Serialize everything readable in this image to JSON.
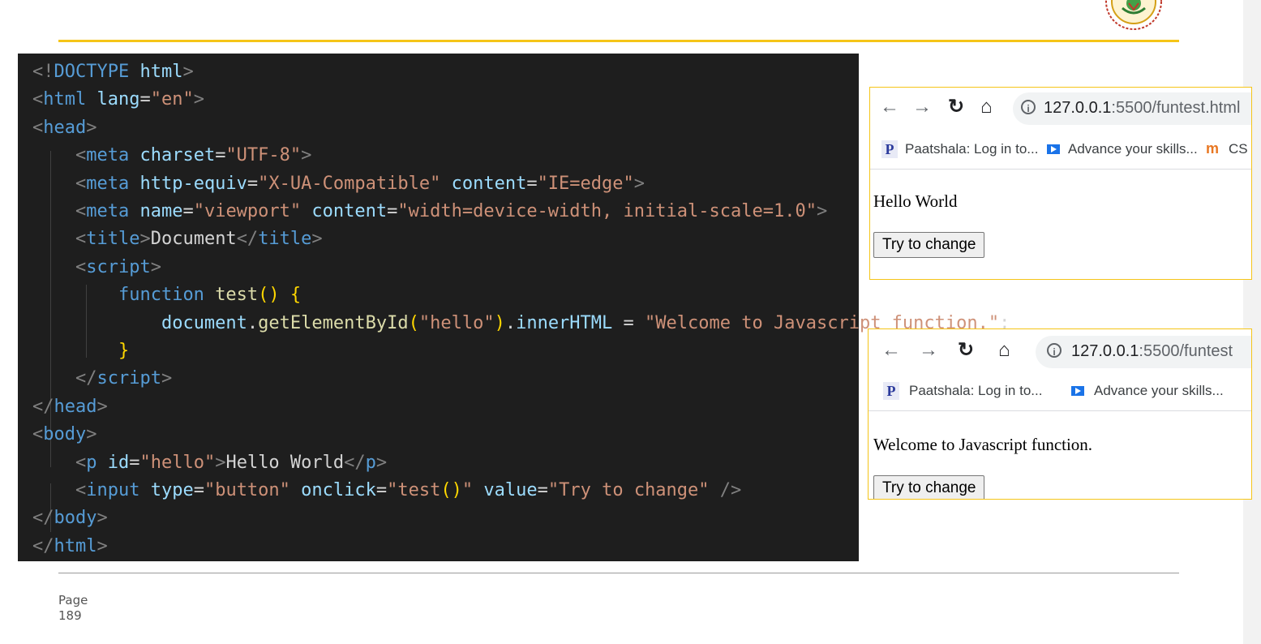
{
  "code_lines": [
    {
      "indent": 0,
      "tokens": [
        [
          "p",
          "<!"
        ],
        [
          "t",
          "DOCTYPE"
        ],
        [
          "w",
          " "
        ],
        [
          "a",
          "html"
        ],
        [
          "p",
          ">"
        ]
      ]
    },
    {
      "indent": 0,
      "tokens": [
        [
          "p",
          "<"
        ],
        [
          "t",
          "html"
        ],
        [
          "w",
          " "
        ],
        [
          "a",
          "lang"
        ],
        [
          "w",
          "="
        ],
        [
          "s",
          "\"en\""
        ],
        [
          "p",
          ">"
        ]
      ]
    },
    {
      "indent": 0,
      "tokens": [
        [
          "p",
          "<"
        ],
        [
          "t",
          "head"
        ],
        [
          "p",
          ">"
        ]
      ]
    },
    {
      "indent": 1,
      "tokens": [
        [
          "p",
          "<"
        ],
        [
          "t",
          "meta"
        ],
        [
          "w",
          " "
        ],
        [
          "a",
          "charset"
        ],
        [
          "w",
          "="
        ],
        [
          "s",
          "\"UTF-8\""
        ],
        [
          "p",
          ">"
        ]
      ]
    },
    {
      "indent": 1,
      "tokens": [
        [
          "p",
          "<"
        ],
        [
          "t",
          "meta"
        ],
        [
          "w",
          " "
        ],
        [
          "a",
          "http-equiv"
        ],
        [
          "w",
          "="
        ],
        [
          "s",
          "\"X-UA-Compatible\""
        ],
        [
          "w",
          " "
        ],
        [
          "a",
          "content"
        ],
        [
          "w",
          "="
        ],
        [
          "s",
          "\"IE=edge\""
        ],
        [
          "p",
          ">"
        ]
      ]
    },
    {
      "indent": 1,
      "tokens": [
        [
          "p",
          "<"
        ],
        [
          "t",
          "meta"
        ],
        [
          "w",
          " "
        ],
        [
          "a",
          "name"
        ],
        [
          "w",
          "="
        ],
        [
          "s",
          "\"viewport\""
        ],
        [
          "w",
          " "
        ],
        [
          "a",
          "content"
        ],
        [
          "w",
          "="
        ],
        [
          "s",
          "\"width=device-width, initial-scale=1.0\""
        ],
        [
          "p",
          ">"
        ]
      ]
    },
    {
      "indent": 1,
      "tokens": [
        [
          "p",
          "<"
        ],
        [
          "t",
          "title"
        ],
        [
          "p",
          ">"
        ],
        [
          "w",
          "Document"
        ],
        [
          "p",
          "</"
        ],
        [
          "t",
          "title"
        ],
        [
          "p",
          ">"
        ]
      ]
    },
    {
      "indent": 1,
      "tokens": [
        [
          "p",
          "<"
        ],
        [
          "t",
          "script"
        ],
        [
          "p",
          ">"
        ]
      ]
    },
    {
      "indent": 2,
      "tokens": [
        [
          "t",
          "function"
        ],
        [
          "w",
          " "
        ],
        [
          "f",
          "test"
        ],
        [
          "br",
          "()"
        ],
        [
          "w",
          " "
        ],
        [
          "br",
          "{"
        ]
      ]
    },
    {
      "indent": 3,
      "tokens": [
        [
          "doc",
          "document"
        ],
        [
          "w",
          "."
        ],
        [
          "f",
          "getElementById"
        ],
        [
          "br",
          "("
        ],
        [
          "s",
          "\"hello\""
        ],
        [
          "br",
          ")"
        ],
        [
          "w",
          "."
        ],
        [
          "doc",
          "innerHTML"
        ],
        [
          "w",
          " = "
        ],
        [
          "s",
          "\"Welcome to Javascript function.\""
        ],
        [
          "w",
          ";"
        ]
      ]
    },
    {
      "indent": 2,
      "tokens": [
        [
          "br",
          "}"
        ]
      ]
    },
    {
      "indent": 1,
      "tokens": [
        [
          "p",
          "</"
        ],
        [
          "t",
          "script"
        ],
        [
          "p",
          ">"
        ]
      ]
    },
    {
      "indent": 0,
      "tokens": [
        [
          "p",
          "</"
        ],
        [
          "t",
          "head"
        ],
        [
          "p",
          ">"
        ]
      ]
    },
    {
      "indent": 0,
      "tokens": [
        [
          "p",
          "<"
        ],
        [
          "t",
          "body"
        ],
        [
          "p",
          ">"
        ]
      ]
    },
    {
      "indent": 1,
      "tokens": [
        [
          "p",
          "<"
        ],
        [
          "t",
          "p"
        ],
        [
          "w",
          " "
        ],
        [
          "a",
          "id"
        ],
        [
          "w",
          "="
        ],
        [
          "s",
          "\"hello\""
        ],
        [
          "p",
          ">"
        ],
        [
          "w",
          "Hello World"
        ],
        [
          "p",
          "</"
        ],
        [
          "t",
          "p"
        ],
        [
          "p",
          ">"
        ]
      ]
    },
    {
      "indent": 1,
      "tokens": [
        [
          "p",
          "<"
        ],
        [
          "t",
          "input"
        ],
        [
          "w",
          " "
        ],
        [
          "a",
          "type"
        ],
        [
          "w",
          "="
        ],
        [
          "s",
          "\"button\""
        ],
        [
          "w",
          " "
        ],
        [
          "a",
          "onclick"
        ],
        [
          "w",
          "="
        ],
        [
          "s",
          "\"test"
        ],
        [
          "br",
          "()"
        ],
        [
          "s",
          "\""
        ],
        [
          "w",
          " "
        ],
        [
          "a",
          "value"
        ],
        [
          "w",
          "="
        ],
        [
          "s",
          "\"Try to change\""
        ],
        [
          "w",
          " "
        ],
        [
          "p",
          "/>"
        ]
      ]
    },
    {
      "indent": 0,
      "tokens": [
        [
          "p",
          "</"
        ],
        [
          "t",
          "body"
        ],
        [
          "p",
          ">"
        ]
      ]
    },
    {
      "indent": 0,
      "tokens": [
        [
          "p",
          "</"
        ],
        [
          "t",
          "html"
        ],
        [
          "p",
          ">"
        ]
      ]
    }
  ],
  "browser1": {
    "url_host": "127.0.0.1",
    "url_path": ":5500/funtest.html",
    "bookmarks": [
      "Paatshala: Log in to...",
      "Advance your skills...",
      "CS"
    ],
    "paragraph": "Hello World",
    "button_label": "Try to change"
  },
  "browser2": {
    "url_host": "127.0.0.1",
    "url_path": ":5500/funtest",
    "bookmarks": [
      "Paatshala: Log in to...",
      "Advance your skills..."
    ],
    "paragraph": "Welcome to Javascript function.",
    "button_label": "Try to change"
  },
  "footer": {
    "page_word": "Page",
    "page_number": "189"
  }
}
